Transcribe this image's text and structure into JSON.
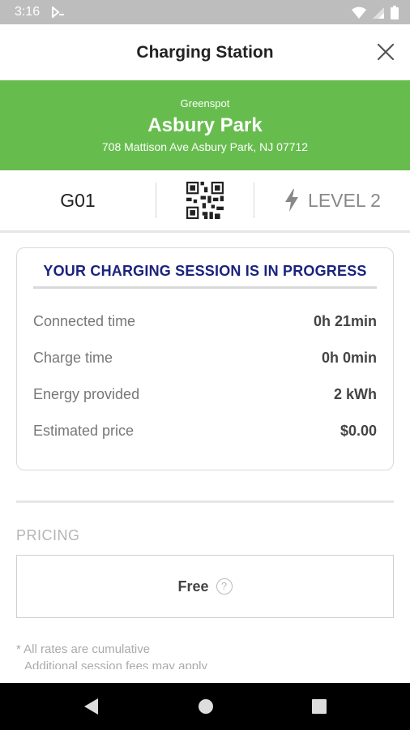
{
  "status_bar": {
    "time": "3:16",
    "icons": [
      "notification-icon",
      "wifi-icon",
      "signal-icon",
      "battery-icon"
    ]
  },
  "app_bar": {
    "title": "Charging Station",
    "close_icon": "close-icon"
  },
  "banner": {
    "network": "Greenspot",
    "name": "Asbury Park",
    "address": "708 Mattison Ave Asbury Park, NJ 07712",
    "color": "#66bd4e"
  },
  "station_info": {
    "id": "G01",
    "qr_icon": "qr-code-icon",
    "level_icon": "lightning-bolt-icon",
    "level": "LEVEL 2"
  },
  "session": {
    "heading": "YOUR CHARGING SESSION IS IN PROGRESS",
    "heading_color": "#1a237e",
    "rows": [
      {
        "label": "Connected time",
        "value": "0h 21min"
      },
      {
        "label": "Charge time",
        "value": "0h 0min"
      },
      {
        "label": "Energy provided",
        "value": "2 kWh"
      },
      {
        "label": "Estimated price",
        "value": "$0.00"
      }
    ]
  },
  "pricing": {
    "label": "PRICING",
    "value": "Free",
    "help_icon": "help-icon",
    "help_glyph": "?"
  },
  "notes": {
    "line1": "* All rates are cumulative",
    "line2": "Additional session fees may apply"
  },
  "nav_bar": {
    "back": "back-icon",
    "home": "home-icon",
    "recents": "recents-icon"
  }
}
